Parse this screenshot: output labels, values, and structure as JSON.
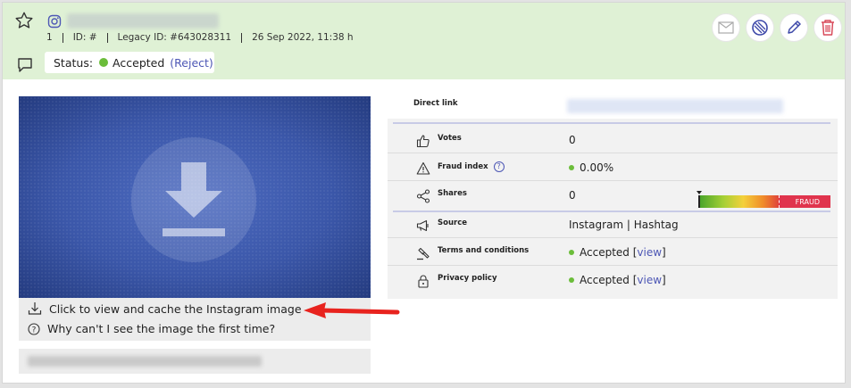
{
  "header": {
    "meta": {
      "number": "1",
      "id": "ID: #",
      "legacy_id": "Legacy ID: #643028311",
      "date": "26 Sep 2022, 11:38 h"
    },
    "status_label": "Status:",
    "status_value": "Accepted",
    "reject_link": "(Reject)",
    "background_color": "#dff1d5"
  },
  "media": {
    "cache_text": "Click to view and cache the Instagram image",
    "why_text": "Why can't I see the image the first time?"
  },
  "details": {
    "direct_link_label": "Direct link",
    "rows": [
      {
        "label": "Votes",
        "value": "0",
        "icon": "thumbs-up-icon"
      },
      {
        "label": "Fraud index",
        "value": "0.00%",
        "icon": "warning-icon",
        "fraud_level_fraction": 0.0,
        "fraud_bar_label": "FRAUD"
      },
      {
        "label": "Shares",
        "value": "0",
        "icon": "share-icon"
      },
      {
        "label": "Source",
        "value": "Instagram | Hashtag",
        "icon": "megaphone-icon"
      },
      {
        "label": "Terms and conditions",
        "value": "Accepted [",
        "link": "view",
        "suffix": "]",
        "icon": "gavel-icon"
      },
      {
        "label": "Privacy policy",
        "value": "Accepted [",
        "link": "view",
        "suffix": "]",
        "icon": "lock-icon"
      }
    ]
  },
  "colors": {
    "accent": "#4d57b5",
    "accepted_green": "#6bbd3a",
    "danger": "#e0344d"
  }
}
